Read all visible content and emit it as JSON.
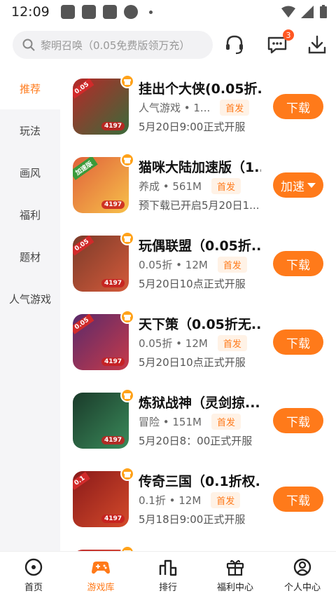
{
  "status_bar": {
    "time": "12:09"
  },
  "search": {
    "placeholder": "黎明召唤（0.05免费版领万充）"
  },
  "header": {
    "message_badge": "3"
  },
  "sidebar": {
    "items": [
      {
        "label": "推荐",
        "active": true
      },
      {
        "label": "玩法"
      },
      {
        "label": "画风"
      },
      {
        "label": "福利"
      },
      {
        "label": "题材"
      },
      {
        "label": "人气游戏"
      }
    ]
  },
  "games": [
    {
      "name": "挂出个大侠(0.05折...",
      "meta": "人气游戏 • 1...",
      "tag": "首发",
      "release": "5月20日9:00正式开服",
      "action": "下载",
      "icon_tag": "4197",
      "ribbon": "0.05",
      "colors": [
        "#b72828",
        "#3a6b3a"
      ]
    },
    {
      "name": "猫咪大陆加速版（1...",
      "meta": "养成 • 561M",
      "tag": "首发",
      "release": "预下载已开启5月20日1...",
      "action": "加速",
      "icon_tag": "4197",
      "ribbon": "加速版",
      "colors": [
        "#e0623a",
        "#f7c04a"
      ]
    },
    {
      "name": "玩偶联盟（0.05折...",
      "meta": "0.05折 • 12M",
      "tag": "首发",
      "release": "5月20日10点正式开服",
      "action": "下载",
      "icon_tag": "4197",
      "ribbon": "0.05",
      "colors": [
        "#7b3b2a",
        "#d45a3a"
      ]
    },
    {
      "name": "天下策（0.05折无...",
      "meta": "0.05折 • 12M",
      "tag": "首发",
      "release": "5月20日10点正式开服",
      "action": "下载",
      "icon_tag": "4197",
      "ribbon": "0.05",
      "colors": [
        "#5a2a6a",
        "#c73a4a"
      ]
    },
    {
      "name": "炼狱战神（灵剑掠...",
      "meta": "冒险 • 151M",
      "tag": "首发",
      "release": "5月20日8：00正式开服",
      "action": "下载",
      "icon_tag": "4197",
      "ribbon": "",
      "colors": [
        "#1a3a2a",
        "#3a8a5a"
      ]
    },
    {
      "name": "传奇三国（0.1折权...",
      "meta": "0.1折 • 12M",
      "tag": "首发",
      "release": "5月18日9:00正式开服",
      "action": "下载",
      "icon_tag": "4197",
      "ribbon": "0.1",
      "colors": [
        "#8a1a1a",
        "#d44a2a"
      ]
    }
  ],
  "bottom_nav": [
    {
      "label": "首页",
      "icon": "home-icon"
    },
    {
      "label": "游戏库",
      "icon": "gamepad-icon",
      "active": true
    },
    {
      "label": "排行",
      "icon": "ranking-icon"
    },
    {
      "label": "福利中心",
      "icon": "gift-icon"
    },
    {
      "label": "个人中心",
      "icon": "user-icon"
    }
  ],
  "colors": {
    "accent": "#ff7a1a",
    "sidebar_bg": "#f5f5f7"
  }
}
